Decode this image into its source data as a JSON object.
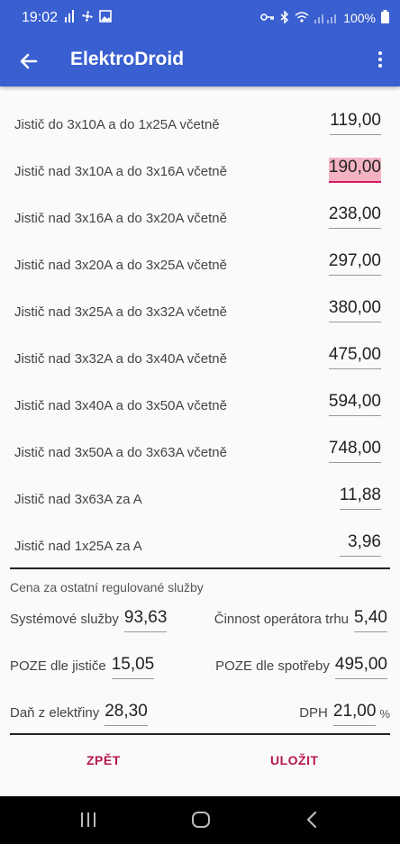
{
  "status": {
    "time": "19:02",
    "battery": "100%"
  },
  "appbar": {
    "title": "ElektroDroid"
  },
  "rows": [
    {
      "label": "Jistič do 3x10A a do 1x25A včetně",
      "value": "119,00"
    },
    {
      "label": "Jistič nad 3x10A a do 3x16A včetně",
      "value": "190,00"
    },
    {
      "label": "Jistič nad 3x16A a do 3x20A včetně",
      "value": "238,00"
    },
    {
      "label": "Jistič nad 3x20A a do 3x25A včetně",
      "value": "297,00"
    },
    {
      "label": "Jistič nad 3x25A a do 3x32A včetně",
      "value": "380,00"
    },
    {
      "label": "Jistič nad 3x32A a do 3x40A včetně",
      "value": "475,00"
    },
    {
      "label": "Jistič nad 3x40A a do 3x50A včetně",
      "value": "594,00"
    },
    {
      "label": "Jistič nad 3x50A a do 3x63A včetně",
      "value": "748,00"
    },
    {
      "label": "Jistič nad 3x63A za A",
      "value": "11,88"
    },
    {
      "label": "Jistič nad 1x25A za A",
      "value": "3,96"
    }
  ],
  "section": {
    "title": "Cena za ostatní regulované služby"
  },
  "fields": {
    "system": {
      "label": "Systémové služby",
      "value": "93,63"
    },
    "operator": {
      "label": "Činnost operátora trhu",
      "value": "5,40"
    },
    "poze_jistic": {
      "label": "POZE dle jističe",
      "value": "15,05"
    },
    "poze_spotreba": {
      "label": "POZE dle spotřeby",
      "value": "495,00"
    },
    "dan": {
      "label": "Daň z elektřiny",
      "value": "28,30"
    },
    "dph": {
      "label": "DPH",
      "value": "21,00",
      "unit": "%"
    }
  },
  "buttons": {
    "back": "ZPĚT",
    "save": "ULOŽIT"
  },
  "colors": {
    "primary": "#3a5fd0",
    "accent": "#b8184c",
    "highlight": "#f4b3c3"
  }
}
